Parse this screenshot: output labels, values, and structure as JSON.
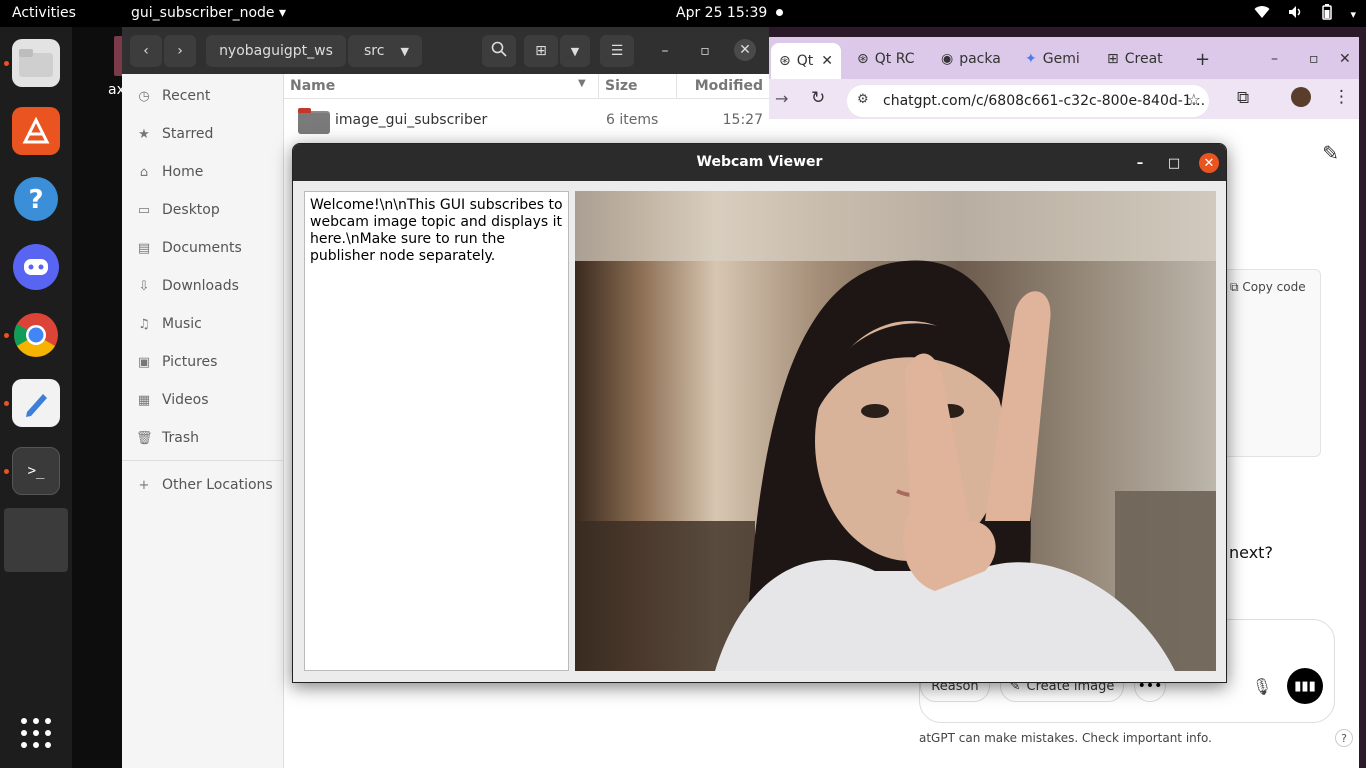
{
  "topbar": {
    "activities": "Activities",
    "app_name": "gui_subscriber_node",
    "clock": "Apr 25  15:39"
  },
  "desktop": {
    "label": "ax"
  },
  "dock": {
    "items": [
      "files-icon",
      "software-store-icon",
      "help-icon",
      "discord-icon",
      "chrome-icon",
      "text-editor-icon",
      "terminal-icon",
      "running-app-icon"
    ],
    "show_apps_icon": "app-grid-icon"
  },
  "files": {
    "path": [
      "nyobaguigpt_ws",
      "src"
    ],
    "sidebar": [
      {
        "icon": "clock-icon",
        "label": "Recent"
      },
      {
        "icon": "star-icon",
        "label": "Starred"
      },
      {
        "icon": "home-icon",
        "label": "Home"
      },
      {
        "icon": "desktop-icon",
        "label": "Desktop"
      },
      {
        "icon": "document-icon",
        "label": "Documents"
      },
      {
        "icon": "download-icon",
        "label": "Downloads"
      },
      {
        "icon": "music-icon",
        "label": "Music"
      },
      {
        "icon": "picture-icon",
        "label": "Pictures"
      },
      {
        "icon": "video-icon",
        "label": "Videos"
      },
      {
        "icon": "trash-icon",
        "label": "Trash"
      },
      {
        "icon": "plus-icon",
        "label": "Other Locations"
      }
    ],
    "columns": {
      "name": "Name",
      "size": "Size",
      "modified": "Modified"
    },
    "rows": [
      {
        "name": "image_gui_subscriber",
        "size": "6 items",
        "modified": "15:27"
      }
    ]
  },
  "browser": {
    "tabs": [
      "Qt",
      "Qt RC",
      "packa",
      "Gemi",
      "Creat"
    ],
    "url": "chatgpt.com/c/6808c661-c32c-800e-840d-1...",
    "copy_code": "Copy code",
    "next_text": "next?",
    "reason": "Reason",
    "create_image": "Create image",
    "disclaimer": "atGPT can make mistakes. Check important info.",
    "help": "?"
  },
  "viewer": {
    "title": "Webcam Viewer",
    "message": "Welcome!\\n\\nThis GUI subscribes to webcam image topic and displays it here.\\nMake sure to run the publisher node separately."
  }
}
